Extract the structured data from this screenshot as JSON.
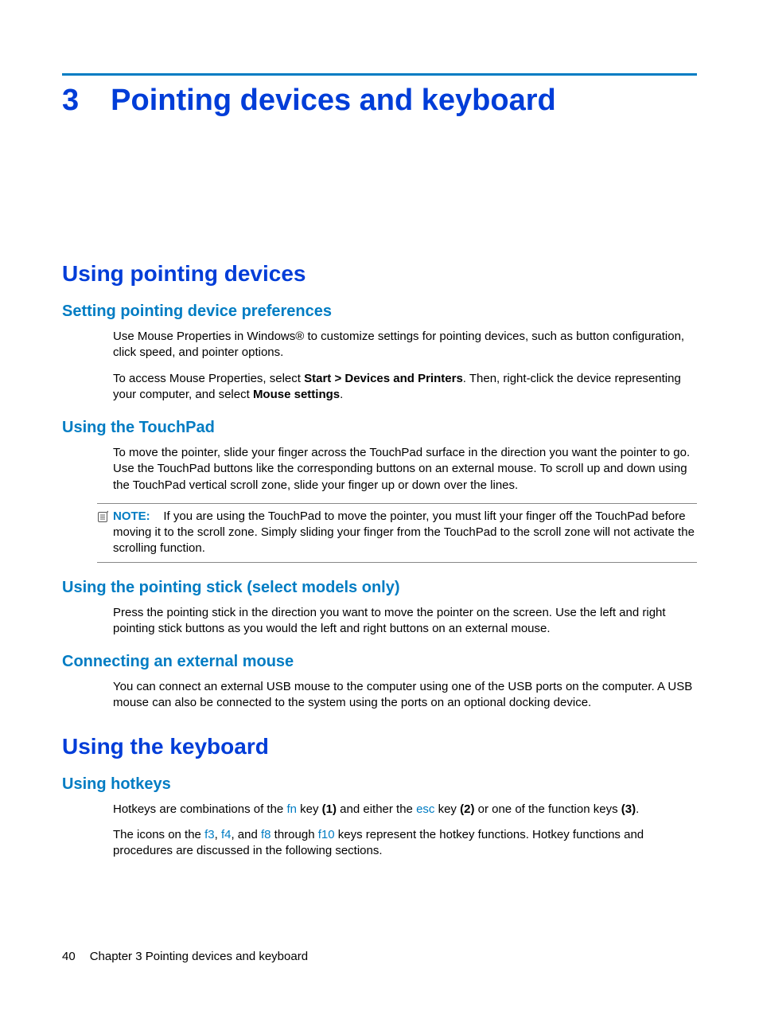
{
  "chapter": {
    "number": "3",
    "title": "Pointing devices and keyboard"
  },
  "section1": {
    "title": "Using pointing devices",
    "sub1": {
      "title": "Setting pointing device preferences",
      "p1": "Use Mouse Properties in Windows® to customize settings for pointing devices, such as button configuration, click speed, and pointer options.",
      "p2a": "To access Mouse Properties, select ",
      "p2b": "Start > Devices and Printers",
      "p2c": ". Then, right-click the device representing your computer, and select ",
      "p2d": "Mouse settings",
      "p2e": "."
    },
    "sub2": {
      "title": "Using the TouchPad",
      "p1": "To move the pointer, slide your finger across the TouchPad surface in the direction you want the pointer to go. Use the TouchPad buttons like the corresponding buttons on an external mouse. To scroll up and down using the TouchPad vertical scroll zone, slide your finger up or down over the lines.",
      "note_label": "NOTE:",
      "note_text": "If you are using the TouchPad to move the pointer, you must lift your finger off the TouchPad before moving it to the scroll zone. Simply sliding your finger from the TouchPad to the scroll zone will not activate the scrolling function."
    },
    "sub3": {
      "title": "Using the pointing stick (select models only)",
      "p1": "Press the pointing stick in the direction you want to move the pointer on the screen. Use the left and right pointing stick buttons as you would the left and right buttons on an external mouse."
    },
    "sub4": {
      "title": "Connecting an external mouse",
      "p1": "You can connect an external USB mouse to the computer using one of the USB ports on the computer. A USB mouse can also be connected to the system using the ports on an optional docking device."
    }
  },
  "section2": {
    "title": "Using the keyboard",
    "sub1": {
      "title": "Using hotkeys",
      "p1_a": "Hotkeys are combinations of the ",
      "p1_fn": "fn",
      "p1_b": " key ",
      "p1_m1": "(1)",
      "p1_c": " and either the ",
      "p1_esc": "esc",
      "p1_d": " key ",
      "p1_m2": "(2)",
      "p1_e": " or one of the function keys ",
      "p1_m3": "(3)",
      "p1_f": ".",
      "p2_a": "The icons on the ",
      "p2_f3": "f3",
      "p2_b": ", ",
      "p2_f4": "f4",
      "p2_c": ", and ",
      "p2_f8": "f8",
      "p2_d": " through ",
      "p2_f10": "f10",
      "p2_e": " keys represent the hotkey functions. Hotkey functions and procedures are discussed in the following sections."
    }
  },
  "footer": {
    "page": "40",
    "text": "Chapter 3   Pointing devices and keyboard"
  }
}
